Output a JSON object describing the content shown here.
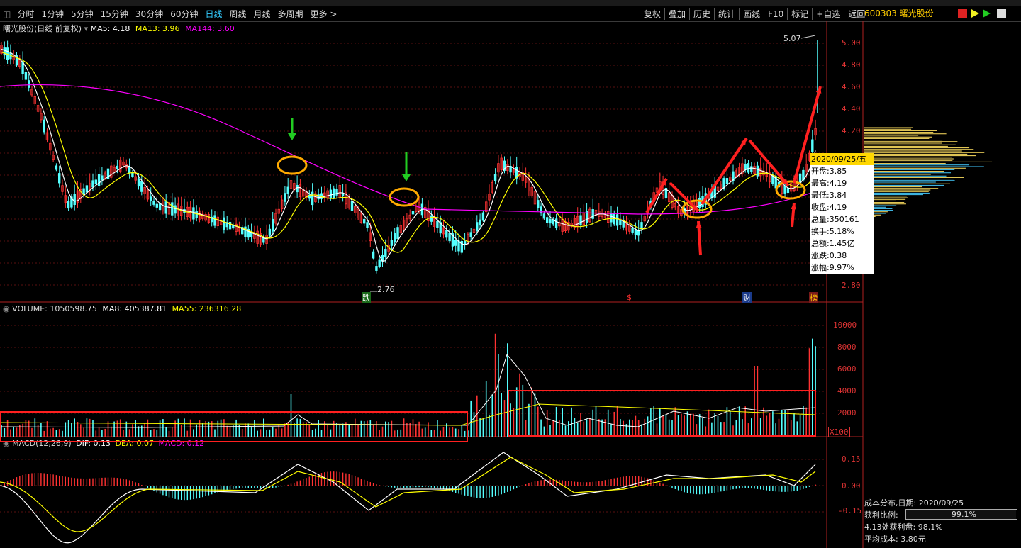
{
  "toolbar": {
    "periods": [
      "分时",
      "1分钟",
      "5分钟",
      "15分钟",
      "30分钟",
      "60分钟",
      "日线",
      "周线",
      "月线",
      "多周期",
      "更多 >"
    ],
    "active_period": "日线",
    "tools": [
      "复权",
      "叠加",
      "历史",
      "统计",
      "画线",
      "F10",
      "标记",
      "+自选",
      "返回"
    ]
  },
  "stock": {
    "code_name": "600303 曙光股份"
  },
  "price_panel": {
    "title": "曙光股份(日线 前复权)",
    "ma5": "MA5: 4.18",
    "ma13": "MA13: 3.96",
    "ma144": "MA144: 3.60",
    "high_label": "5.07",
    "low_label": "2.76",
    "y_labels": [
      "5.00",
      "4.80",
      "4.60",
      "4.40",
      "4.20",
      "2.80"
    ],
    "markers": {
      "die": "跌",
      "s": "$",
      "cai": "财",
      "bang": "榜"
    }
  },
  "volume_panel": {
    "volume": "VOLUME: 1050598.75",
    "ma8": "MA8: 405387.81",
    "ma55": "MA55: 236316.28",
    "y_labels": [
      "10000",
      "8000",
      "6000",
      "4000",
      "2000"
    ],
    "unit": "X100"
  },
  "macd_panel": {
    "title": "MACD(12,26,9)",
    "dif": "DIF: 0.13",
    "dea": "DEA: 0.07",
    "macd": "MACD: 0.12",
    "y_labels": [
      "0.15",
      "0.00",
      "-0.15"
    ]
  },
  "tooltip": {
    "date": "2020/09/25/五",
    "rows": [
      "开盘:3.85",
      "最高:4.19",
      "最低:3.84",
      "收盘:4.19",
      "总量:350161",
      "换手:5.18%",
      "总额:1.45亿",
      "涨跌:0.38",
      "涨幅:9.97%"
    ]
  },
  "chip_distribution": {
    "title": "成本分布,日期: 2020/09/25",
    "profit_label": "获利比例:",
    "profit_value": "99.1%",
    "profit_ratio": 0.991,
    "line1": "4.13处获利盘: 98.1%",
    "line2": "平均成本: 3.80元"
  },
  "colors": {
    "up": "#ff3232",
    "down": "#54ffff",
    "ma5": "#ffffff",
    "ma13": "#ffff00",
    "ma144": "#ff00ff",
    "annotation": "#ff2020",
    "circle": "#ffaa00",
    "green_arrow": "#22cc22"
  }
}
